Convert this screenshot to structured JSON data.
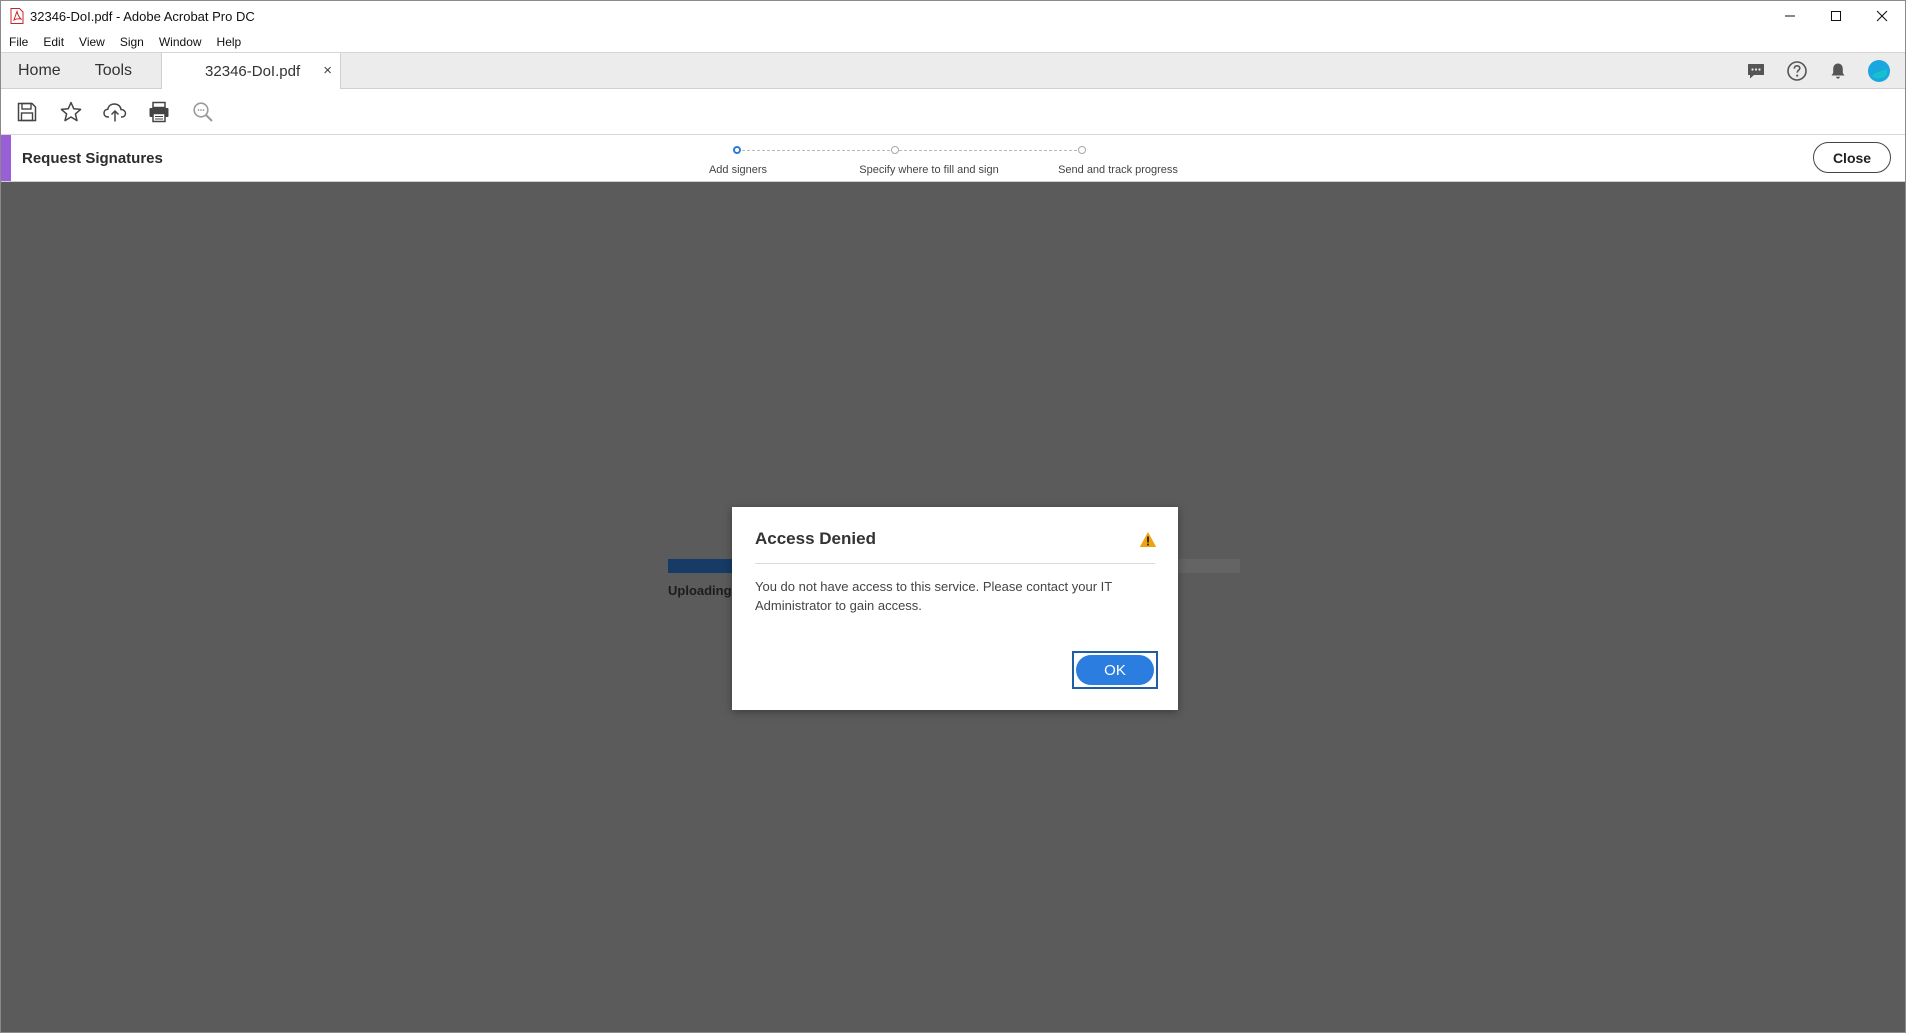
{
  "window": {
    "title": "32346-DoI.pdf - Adobe Acrobat Pro DC",
    "app_icon": "acrobat-pdf-icon",
    "controls": [
      "minimize-icon",
      "maximize-icon",
      "close-icon"
    ]
  },
  "menubar": {
    "items": [
      "File",
      "Edit",
      "View",
      "Sign",
      "Window",
      "Help"
    ]
  },
  "tabs": {
    "home_label": "Home",
    "tools_label": "Tools",
    "document_label": "32346-DoI.pdf",
    "close_glyph": "×",
    "right_icons": [
      "comment-icon",
      "help-icon",
      "bell-icon",
      "profile-avatar-icon"
    ]
  },
  "toolbar": {
    "icons": [
      "save-icon",
      "star-icon",
      "cloud-upload-icon",
      "print-icon",
      "search-icon"
    ]
  },
  "request_signatures": {
    "title": "Request Signatures",
    "accent_color": "#9a5fd8",
    "steps": [
      {
        "label": "Add signers",
        "active": true
      },
      {
        "label": "Specify where to fill and sign",
        "active": false
      },
      {
        "label": "Send and track progress",
        "active": false
      }
    ],
    "close_label": "Close"
  },
  "upload": {
    "label": "Uploading",
    "progress_fraction": 0.13,
    "bar_color": "#163b66"
  },
  "dialog": {
    "title": "Access Denied",
    "icon": "warning-icon",
    "warning_color": "#f0a30a",
    "message": "You do not have access to this service. Please contact your IT Administrator to gain access.",
    "ok_label": "OK",
    "ok_color": "#2b7ee0"
  }
}
